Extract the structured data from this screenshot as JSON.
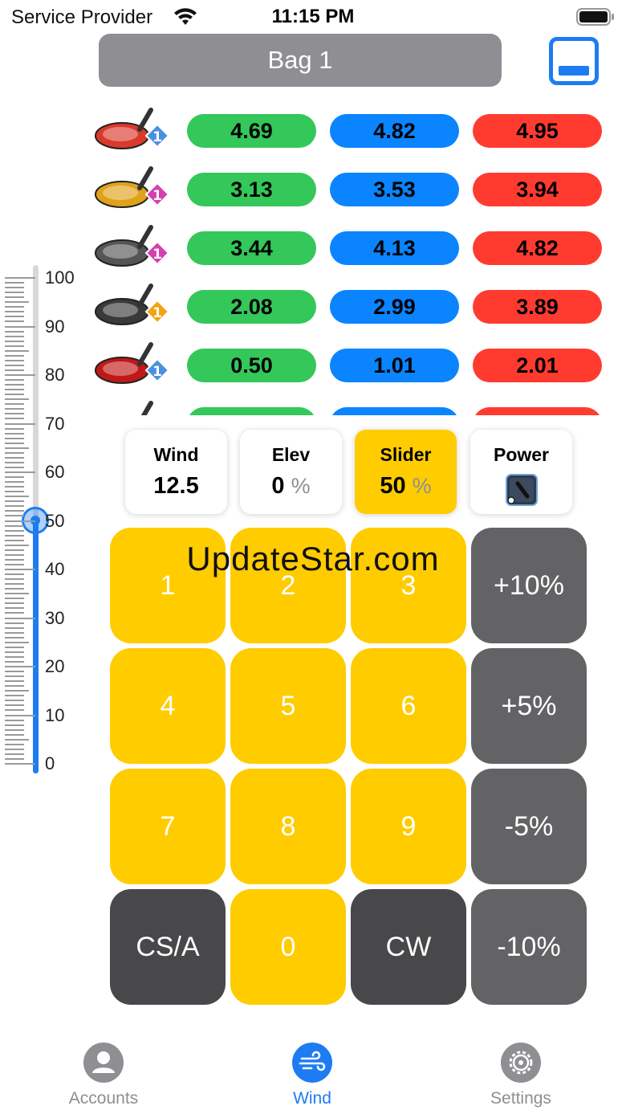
{
  "status_bar": {
    "carrier": "Service Provider",
    "time": "11:15 PM"
  },
  "header": {
    "title": "Bag 1"
  },
  "clubs": [
    {
      "level": "1",
      "badge_color": "#4a90e2",
      "values": [
        "4.69",
        "4.82",
        "4.95"
      ]
    },
    {
      "level": "1",
      "badge_color": "#d63fb0",
      "values": [
        "3.13",
        "3.53",
        "3.94"
      ]
    },
    {
      "level": "1",
      "badge_color": "#d63fb0",
      "values": [
        "3.44",
        "4.13",
        "4.82"
      ]
    },
    {
      "level": "1",
      "badge_color": "#f2a40e",
      "values": [
        "2.08",
        "2.99",
        "3.89"
      ]
    },
    {
      "level": "1",
      "badge_color": "#4a90e2",
      "values": [
        "0.50",
        "1.01",
        "2.01"
      ]
    },
    {
      "level": "",
      "badge_color": "#4a90e2",
      "values": [
        "",
        "",
        ""
      ]
    }
  ],
  "slider": {
    "labels": [
      "100",
      "90",
      "80",
      "70",
      "60",
      "50",
      "40",
      "30",
      "20",
      "10",
      "0"
    ],
    "value": 50,
    "max": 100
  },
  "cards": {
    "wind": {
      "title": "Wind",
      "value": "12.5"
    },
    "elev": {
      "title": "Elev",
      "value": "0",
      "unit": "%"
    },
    "slider": {
      "title": "Slider",
      "value": "50",
      "unit": "%"
    },
    "power": {
      "title": "Power",
      "icon": "power-icon"
    }
  },
  "keypad": {
    "k1": "1",
    "k2": "2",
    "k3": "3",
    "plus10": "+10%",
    "k4": "4",
    "k5": "5",
    "k6": "6",
    "plus5": "+5%",
    "k7": "7",
    "k8": "8",
    "k9": "9",
    "minus5": "-5%",
    "csa": "CS/A",
    "k0": "0",
    "cw": "CW",
    "minus10": "-10%"
  },
  "watermark": "UpdateStar.com",
  "tabs": [
    {
      "label": "Accounts",
      "icon": "person-icon",
      "active": false
    },
    {
      "label": "Wind",
      "icon": "wind-icon",
      "active": true
    },
    {
      "label": "Settings",
      "icon": "gear-icon",
      "active": false
    }
  ],
  "colors": {
    "accent": "#1e7cf2",
    "green": "#34c759",
    "blue": "#0a84ff",
    "red": "#ff3b30",
    "key_yellow": "#ffcc00",
    "key_gray": "#636366",
    "key_dark": "#48484a",
    "tab_inactive": "#8e8e93"
  }
}
